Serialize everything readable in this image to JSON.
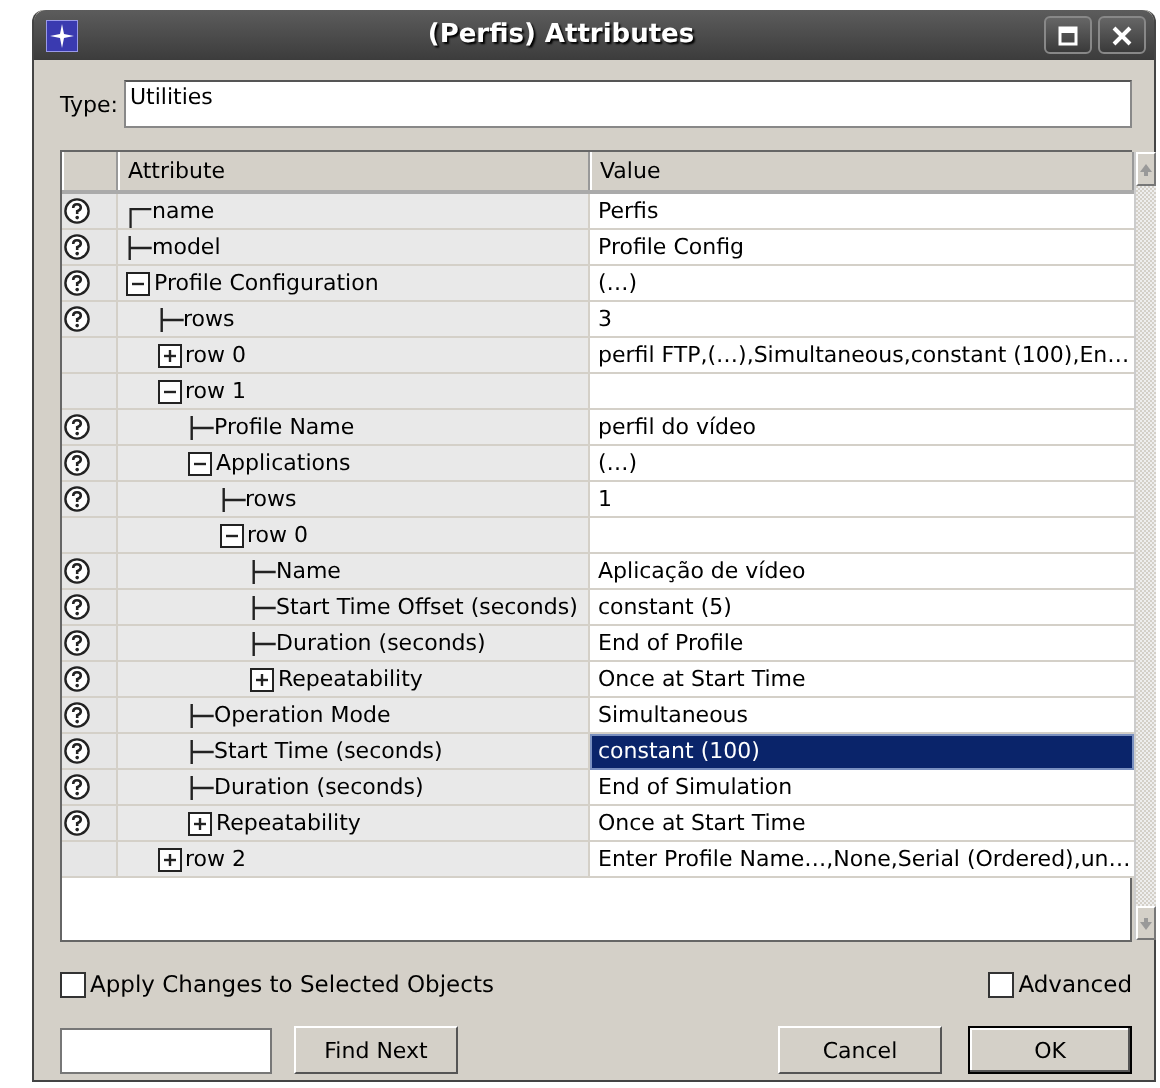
{
  "window": {
    "title": "(Perfis) Attributes"
  },
  "type": {
    "label": "Type:",
    "value": "Utilities"
  },
  "table": {
    "columns": [
      "Attribute",
      "Value"
    ],
    "rows": [
      {
        "label": "name",
        "value": "Perfis",
        "help": true,
        "kind": "leaf",
        "selected": false
      },
      {
        "label": "model",
        "value": "Profile Config",
        "help": true,
        "kind": "leaf",
        "selected": false
      },
      {
        "label": "Profile Configuration",
        "value": "(…)",
        "help": true,
        "kind": "group",
        "expanded": true,
        "selected": false,
        "children": [
          {
            "label": "rows",
            "value": "3",
            "help": true,
            "kind": "leaf",
            "selected": false
          },
          {
            "label": "row 0",
            "value": "perfil FTP,(…),Simultaneous,constant (100),En…",
            "help": false,
            "kind": "group",
            "expanded": false,
            "selected": false
          },
          {
            "label": "row 1",
            "help": false,
            "kind": "group",
            "expanded": true,
            "selected": false,
            "children": [
              {
                "label": "Profile Name",
                "value": "perfil do vídeo",
                "help": true,
                "kind": "leaf",
                "selected": false
              },
              {
                "label": "Applications",
                "value": "(…)",
                "help": true,
                "kind": "group",
                "expanded": true,
                "selected": false,
                "children": [
                  {
                    "label": "rows",
                    "value": "1",
                    "help": true,
                    "kind": "leaf",
                    "selected": false
                  },
                  {
                    "label": "row 0",
                    "help": false,
                    "kind": "group",
                    "expanded": true,
                    "selected": false,
                    "children": [
                      {
                        "label": "Name",
                        "value": "Aplicação de vídeo",
                        "help": true,
                        "kind": "leaf",
                        "selected": false
                      },
                      {
                        "label": "Start Time Offset (seconds)",
                        "value": "constant (5)",
                        "help": true,
                        "kind": "leaf",
                        "selected": false
                      },
                      {
                        "label": "Duration (seconds)",
                        "value": "End of Profile",
                        "help": true,
                        "kind": "leaf",
                        "selected": false
                      },
                      {
                        "label": "Repeatability",
                        "value": "Once at Start Time",
                        "help": true,
                        "kind": "group",
                        "expanded": false,
                        "selected": false
                      }
                    ]
                  }
                ]
              },
              {
                "label": "Operation Mode",
                "value": "Simultaneous",
                "help": true,
                "kind": "leaf",
                "selected": false
              },
              {
                "label": "Start Time (seconds)",
                "value": "constant (100)",
                "help": true,
                "kind": "leaf",
                "selected": true
              },
              {
                "label": "Duration (seconds)",
                "value": "End of Simulation",
                "help": true,
                "kind": "leaf",
                "selected": false
              },
              {
                "label": "Repeatability",
                "value": "Once at Start Time",
                "help": true,
                "kind": "group",
                "expanded": false,
                "selected": false
              }
            ]
          },
          {
            "label": "row 2",
            "value": "Enter Profile Name…,None,Serial (Ordered),un…",
            "help": false,
            "kind": "group",
            "expanded": false,
            "selected": false
          }
        ]
      }
    ]
  },
  "options": [
    {
      "label": "Apply Changes to Selected Objects",
      "checked": false
    },
    {
      "label": "Advanced",
      "checked": false
    }
  ],
  "buttons": [
    "Find Next",
    "Cancel",
    "OK"
  ]
}
